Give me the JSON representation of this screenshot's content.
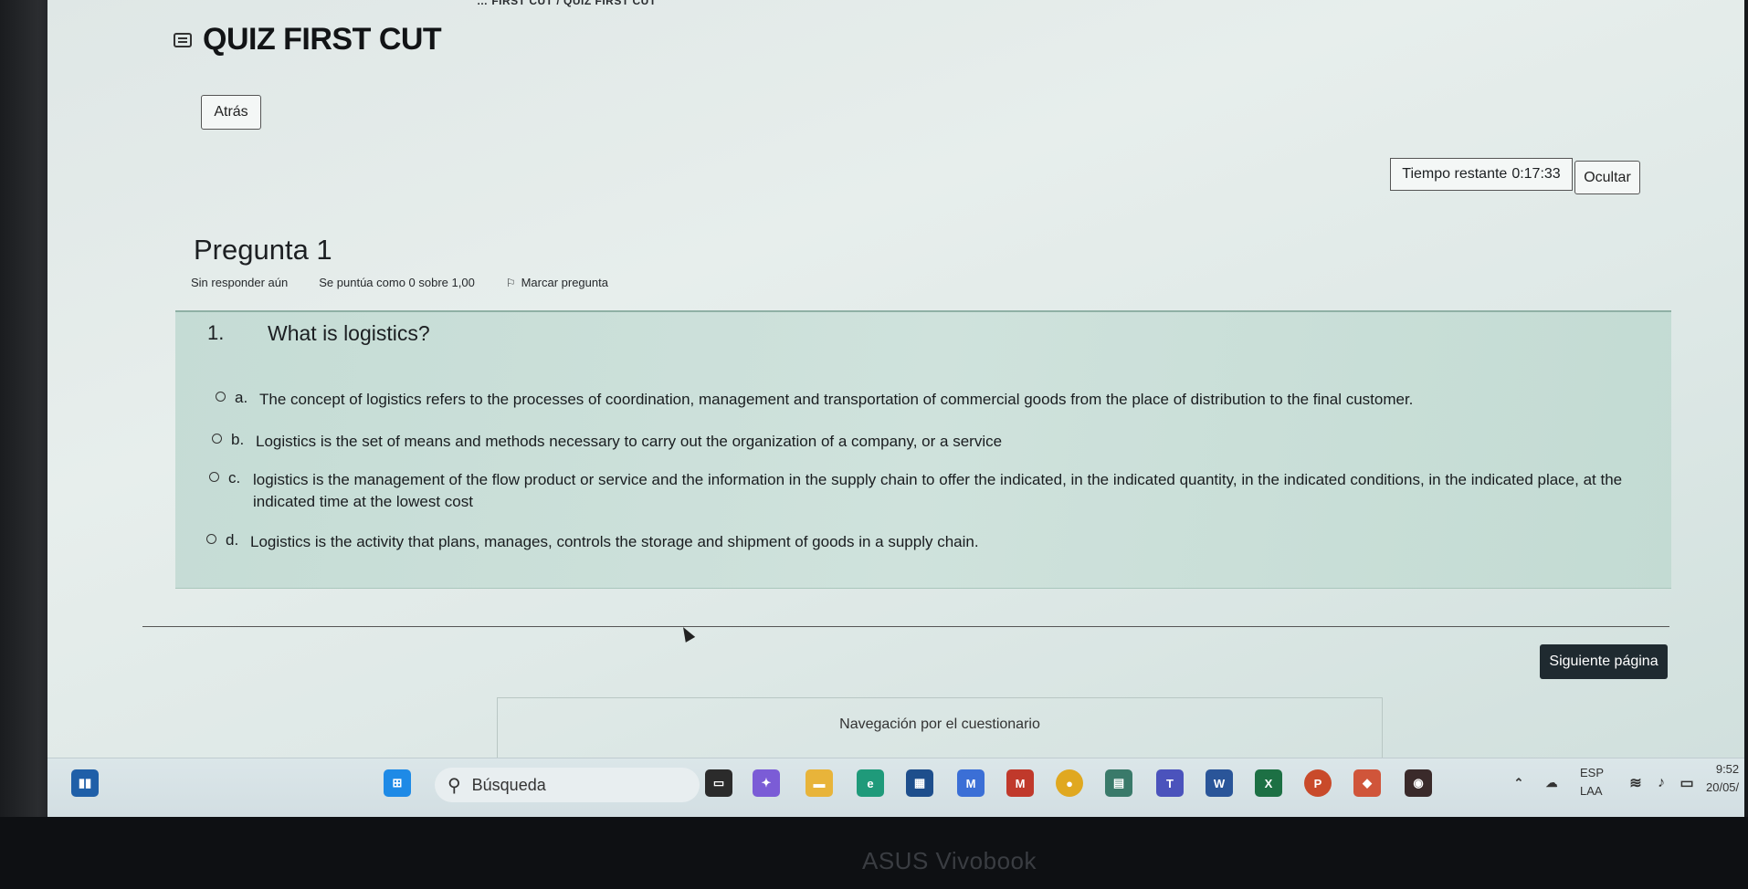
{
  "breadcrumb": "… FIRST CUT / QUIZ FIRST CUT",
  "header": {
    "title": "QUIZ FIRST CUT",
    "icon": "quiz-icon"
  },
  "back_button": "Atrás",
  "timer": {
    "label": "Tiempo restante",
    "value": "0:17:33"
  },
  "hide_button": "Ocultar",
  "question": {
    "title": "Pregunta 1",
    "status": "Sin responder aún",
    "grade": "Se puntúa como 0 sobre 1,00",
    "flag_label": "Marcar pregunta",
    "number": "1.",
    "text": "What is logistics?",
    "options": [
      {
        "letter": "a.",
        "text": "The concept of logistics refers to the processes of coordination, management and transportation of commercial goods from the place of distribution to the final customer."
      },
      {
        "letter": "b.",
        "text": "Logistics is the set of means and methods necessary to carry out the organization of a company, or a service"
      },
      {
        "letter": "c.",
        "text": "logistics is the management of the flow product or service and the information in the supply chain to offer the indicated, in the indicated quantity, in the indicated conditions, in the indicated place, at the indicated time at the lowest cost"
      },
      {
        "letter": "d.",
        "text": "Logistics is the activity that plans, manages, controls the storage and shipment of goods in a supply chain."
      }
    ]
  },
  "next_button": "Siguiente página",
  "quiz_navigation_title": "Navegación por el cuestionario",
  "taskbar": {
    "search_placeholder": "Búsqueda",
    "language": "ESP",
    "keyboard": "LAA",
    "time": "9:52",
    "date": "20/05/"
  },
  "brand": "ASUS Vivobook",
  "colors": {
    "accent_dark": "#1f2a30",
    "question_bg": "#cfe2dc"
  }
}
